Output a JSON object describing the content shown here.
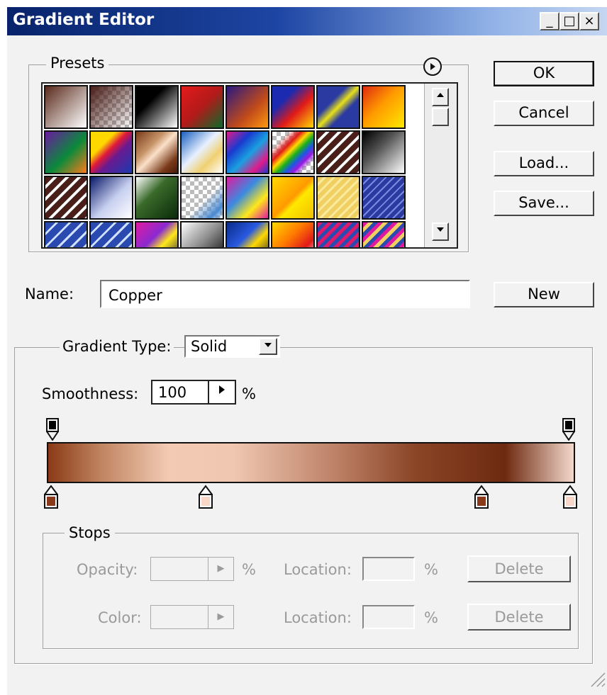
{
  "window": {
    "title": "Gradient Editor",
    "controls": {
      "minimize": "_",
      "maximize": "□",
      "close": "×"
    }
  },
  "presets": {
    "label": "Presets",
    "menu_icon": "circle-arrow-right-icon",
    "swatches": [
      {
        "style": "linear-gradient(135deg,#5a2a1c 0%,#fff 100%)"
      },
      {
        "style": "linear-gradient(135deg,#4a1f1a 0%,rgba(255,255,255,0) 100%),repeating-conic-gradient(#bbb 0% 25%,#fff 0% 50%) 0 0/12px 12px"
      },
      {
        "style": "linear-gradient(135deg,#000 0%,#000 35%,#fff 100%)"
      },
      {
        "style": "linear-gradient(135deg,#e31b1b 0%,#b31a1a 50%,#0a6a2a 100%)"
      },
      {
        "style": "linear-gradient(135deg,#2a1a80 0%,#c04a1a 60%,#ff9a10 100%)"
      },
      {
        "style": "linear-gradient(135deg,#1b2ab0 0%,#1b2ab0 30%,#e01a1a 60%,#ffd800 100%)"
      },
      {
        "style": "linear-gradient(135deg,#2a3aa0 0%,#2a3aa0 35%,#e8e01a 50%,#2a3aa0 65%,#2a3aa0 100%)"
      },
      {
        "style": "linear-gradient(135deg,#e02a10 0%,#ff9a00 45%,#ffe800 100%)"
      },
      {
        "style": "linear-gradient(135deg,#6a1aa0 0%,#0a8a3a 55%,#ff7a1a 100%)"
      },
      {
        "style": "linear-gradient(135deg,#ffd800 0%,#ffd800 30%,#e01a3a 45%,#6a1a90 60%,#1a3ab0 100%)"
      },
      {
        "style": "linear-gradient(135deg,#7a3a1a 0%,#c8956a 35%,#fbe0c8 50%,#7a3a1a 80%,#4a1a0a 100%)"
      },
      {
        "style": "linear-gradient(135deg,#1a60c0 0%,#e8f0ff 45%,#f0d070 70%,#fff 100%)"
      },
      {
        "style": "linear-gradient(135deg,#e01a8a 0%,#1a3ad0 30%,#1aa0e0 55%,#e01a8a 80%,#1a3ad0 100%)"
      },
      {
        "style": "linear-gradient(135deg,transparent 20%,#e01a1a 35%,#ffd800 45%,#1ab01a 55%,#1a5ae0 65%,#9a1ae0 75%,transparent 85%),repeating-conic-gradient(#bbb 0% 25%,#fff 0% 50%) 0 0/12px 12px"
      },
      {
        "style": "repeating-linear-gradient(135deg,#4a1f1a 0 8px,#fff 8px 12px)"
      },
      {
        "style": "linear-gradient(135deg,#000 0%,#555 40%,#fff 100%)"
      },
      {
        "style": "repeating-linear-gradient(135deg,#4a1f1a 0 8px,#fff 8px 12px)"
      },
      {
        "style": "linear-gradient(135deg,#0a1a6a 0%,#c8d0f0 55%,#ffffff 100%)"
      },
      {
        "style": "linear-gradient(135deg,#fff 0%,#3a6a2a 40%,#0a2a0a 100%)"
      },
      {
        "style": "linear-gradient(135deg,rgba(255,255,255,0) 55%,#4a8ad0 85%,rgba(255,255,255,0) 100%),repeating-conic-gradient(#bbb 0% 25%,#fff 0% 50%) 0 0/12px 12px"
      },
      {
        "style": "linear-gradient(135deg,#e01aa0 0%,#3a8ae0 40%,#ffe81a 70%,#e01aa0 100%)"
      },
      {
        "style": "linear-gradient(135deg,#ffd800 0%,#ff9a00 50%,#ffe800 60%,#f0c000 100%)"
      },
      {
        "style": "repeating-linear-gradient(135deg,#f0d060 0 6px,#fbe9a0 6px 9px)"
      },
      {
        "style": "repeating-linear-gradient(135deg,#2a3aa0 0 6px,#7a8ae0 6px 8px)"
      },
      {
        "style": "repeating-linear-gradient(135deg,#2a4ab0 0 10px,#cfe0ff 10px 13px)"
      },
      {
        "style": "repeating-linear-gradient(135deg,#2a4ab0 0 10px,#cfe0ff 10px 13px)"
      },
      {
        "style": "linear-gradient(135deg,#e01aa0 0%,#8a2ad0 40%,#ffe81a 60%,#0a0a4a 100%)"
      },
      {
        "style": "linear-gradient(135deg,#fff 0%,#8a8a8a 50%,#000 100%)"
      },
      {
        "style": "linear-gradient(135deg,#0a2a8a 0%,#2a5ae0 40%,#ffd800 60%,#0a0a3a 100%)"
      },
      {
        "style": "linear-gradient(135deg,#ffd800 0%,#ff7a00 40%,#e01a1a 70%,#fff 100%)"
      },
      {
        "style": "repeating-linear-gradient(135deg,#e01a6a 0 5px,#2a4ab0 5px 10px)"
      },
      {
        "style": "repeating-linear-gradient(135deg,#e01aa0 0 5px,#f0d060 5px 10px,#2a4ab0 10px 15px)"
      }
    ]
  },
  "buttons": {
    "ok": "OK",
    "cancel": "Cancel",
    "load": "Load...",
    "save": "Save...",
    "new": "New"
  },
  "name": {
    "label": "Name:",
    "value": "Copper"
  },
  "gradient": {
    "type_label": "Gradient Type:",
    "type_value": "Solid",
    "smoothness_label": "Smoothness:",
    "smoothness_value": "100",
    "smoothness_unit": "%",
    "colors": {
      "stop_dark": "#8a3a1a",
      "stop_light": "#f8d6c8",
      "opacity_stop": "#000000"
    },
    "bar_stops": [
      {
        "color": "#8a3a16",
        "pos": 0
      },
      {
        "color": "#c08460",
        "pos": 10
      },
      {
        "color": "#f3cbb5",
        "pos": 23
      },
      {
        "color": "#f0c8b2",
        "pos": 35
      },
      {
        "color": "#bc8066",
        "pos": 55
      },
      {
        "color": "#8a4426",
        "pos": 70
      },
      {
        "color": "#6e2a10",
        "pos": 87
      },
      {
        "color": "#f3d8cc",
        "pos": 100
      }
    ]
  },
  "stops": {
    "label": "Stops",
    "opacity_label": "Opacity:",
    "color_label": "Color:",
    "location_label": "Location:",
    "percent": "%",
    "delete_label": "Delete"
  }
}
